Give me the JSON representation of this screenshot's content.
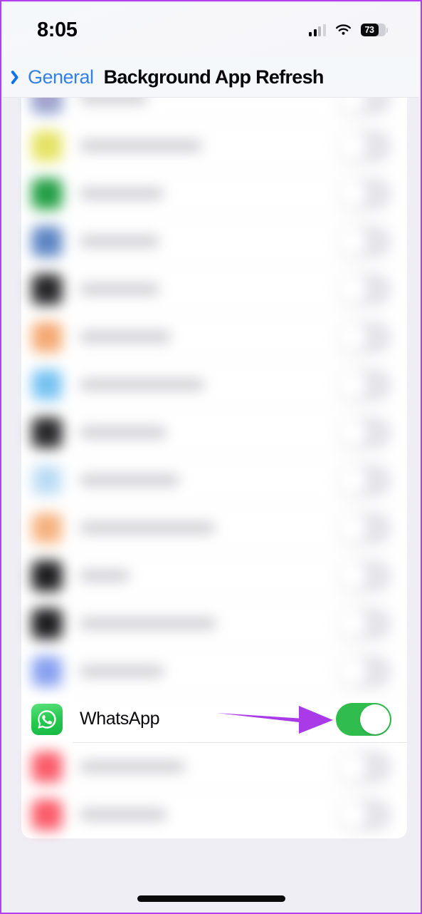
{
  "status_bar": {
    "time": "8:05",
    "battery_percent": "73",
    "cellular_icon": "cellular-signal-icon",
    "wifi_icon": "wifi-icon",
    "battery_icon": "battery-icon"
  },
  "nav_bar": {
    "back_label": "General",
    "back_icon": "chevron-left-icon",
    "title": "Background App Refresh"
  },
  "theme": {
    "accent_blue": "#3380e8",
    "toggle_on_green": "#31bd4e",
    "toggle_off_grey": "#e4e4e9",
    "page_background": "#efeef5",
    "card_background": "#ffffff",
    "frame_border": "#b43df0",
    "annotation_arrow": "#a93ae8"
  },
  "annotation": {
    "arrow_icon": "arrow-right-icon",
    "arrow_color": "#a93ae8",
    "points_to": "whatsapp-toggle"
  },
  "list": {
    "rows": [
      {
        "label": "",
        "icon_color": "#8fa6d4",
        "icon_color2": "#b89fc4",
        "toggle": "off",
        "blurred": true,
        "label_width": 95
      },
      {
        "label": "",
        "icon_color": "#eae870",
        "icon_color2": "#dede5a",
        "toggle": "off",
        "blurred": true,
        "label_width": 172
      },
      {
        "label": "",
        "icon_color": "#2faa4e",
        "icon_color2": "#1d9440",
        "toggle": "off",
        "blurred": true,
        "label_width": 118
      },
      {
        "label": "",
        "icon_color": "#6f93cc",
        "icon_color2": "#4f7bbd",
        "toggle": "off",
        "blurred": true,
        "label_width": 112
      },
      {
        "label": "",
        "icon_color": "#3a3a3c",
        "icon_color2": "#18181a",
        "toggle": "off",
        "blurred": true,
        "label_width": 112
      },
      {
        "label": "",
        "icon_color": "#f7b583",
        "icon_color2": "#f2a068",
        "toggle": "off",
        "blurred": true,
        "label_width": 128
      },
      {
        "label": "",
        "icon_color": "#8ecdf5",
        "icon_color2": "#63b9ef",
        "toggle": "off",
        "blurred": true,
        "label_width": 175
      },
      {
        "label": "",
        "icon_color": "#3c3c3e",
        "icon_color2": "#1b1b1d",
        "toggle": "off",
        "blurred": true,
        "label_width": 122
      },
      {
        "label": "",
        "icon_color": "#cfe5f7",
        "icon_color2": "#a9d4f2",
        "toggle": "off",
        "blurred": true,
        "label_width": 140
      },
      {
        "label": "",
        "icon_color": "#f8bf92",
        "icon_color2": "#f4a76f",
        "toggle": "off",
        "blurred": true,
        "label_width": 190
      },
      {
        "label": "",
        "icon_color": "#2e2e30",
        "icon_color2": "#111113",
        "toggle": "off",
        "blurred": true,
        "label_width": 70
      },
      {
        "label": "",
        "icon_color": "#2e2e30",
        "icon_color2": "#111113",
        "toggle": "off",
        "blurred": true,
        "label_width": 192
      },
      {
        "label": "",
        "icon_color": "#98aef2",
        "icon_color2": "#7b95ee",
        "toggle": "off",
        "blurred": true,
        "label_width": 118
      },
      {
        "label": "WhatsApp",
        "icon_color": "#24c94f",
        "icon_color2": "#17b843",
        "toggle": "on",
        "blurred": false,
        "label_width": 0
      },
      {
        "label": "",
        "icon_color": "#fb6a77",
        "icon_color2": "#f9505f",
        "toggle": "off",
        "blurred": true,
        "label_width": 148
      },
      {
        "label": "",
        "icon_color": "#fb6a77",
        "icon_color2": "#f9505f",
        "toggle": "off",
        "blurred": true,
        "label_width": 122
      }
    ]
  }
}
